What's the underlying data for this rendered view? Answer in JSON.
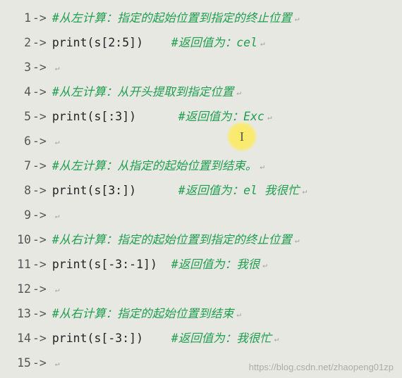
{
  "lines": [
    {
      "n": "1",
      "segs": [
        {
          "t": "comment",
          "v": "#从左计算：指定的起始位置到指定的终止位置"
        }
      ],
      "p": true
    },
    {
      "n": "2",
      "segs": [
        {
          "t": "code",
          "v": "print(s[2:5])    "
        },
        {
          "t": "comment",
          "v": "#返回值为：cel"
        }
      ],
      "p": true
    },
    {
      "n": "3",
      "segs": [],
      "p": true
    },
    {
      "n": "4",
      "segs": [
        {
          "t": "comment",
          "v": "#从左计算：从开头提取到指定位置"
        }
      ],
      "p": true
    },
    {
      "n": "5",
      "segs": [
        {
          "t": "code",
          "v": "print(s[:3])      "
        },
        {
          "t": "comment",
          "v": "#返回值为：Exc"
        }
      ],
      "p": true
    },
    {
      "n": "6",
      "segs": [],
      "p": true
    },
    {
      "n": "7",
      "segs": [
        {
          "t": "comment",
          "v": "#从左计算：从指定的起始位置到结束。"
        }
      ],
      "p": true
    },
    {
      "n": "8",
      "segs": [
        {
          "t": "code",
          "v": "print(s[3:])      "
        },
        {
          "t": "comment",
          "v": "#返回值为：el 我很忙"
        }
      ],
      "p": true
    },
    {
      "n": "9",
      "segs": [],
      "p": true
    },
    {
      "n": "10",
      "segs": [
        {
          "t": "comment",
          "v": "#从右计算：指定的起始位置到指定的终止位置"
        }
      ],
      "p": true
    },
    {
      "n": "11",
      "segs": [
        {
          "t": "code",
          "v": "print(s[-3:-1])  "
        },
        {
          "t": "comment",
          "v": "#返回值为：我很"
        }
      ],
      "p": true
    },
    {
      "n": "12",
      "segs": [],
      "p": true
    },
    {
      "n": "13",
      "segs": [
        {
          "t": "comment",
          "v": "#从右计算：指定的起始位置到结束"
        }
      ],
      "p": true
    },
    {
      "n": "14",
      "segs": [
        {
          "t": "code",
          "v": "print(s[-3:])    "
        },
        {
          "t": "comment",
          "v": "#返回值为：我很忙"
        }
      ],
      "p": true
    },
    {
      "n": "15",
      "segs": [],
      "p": true
    }
  ],
  "arrow": "->",
  "paragraph_mark": "↵",
  "watermark": "https://blog.csdn.net/zhaopeng01zp",
  "cursor": "I"
}
